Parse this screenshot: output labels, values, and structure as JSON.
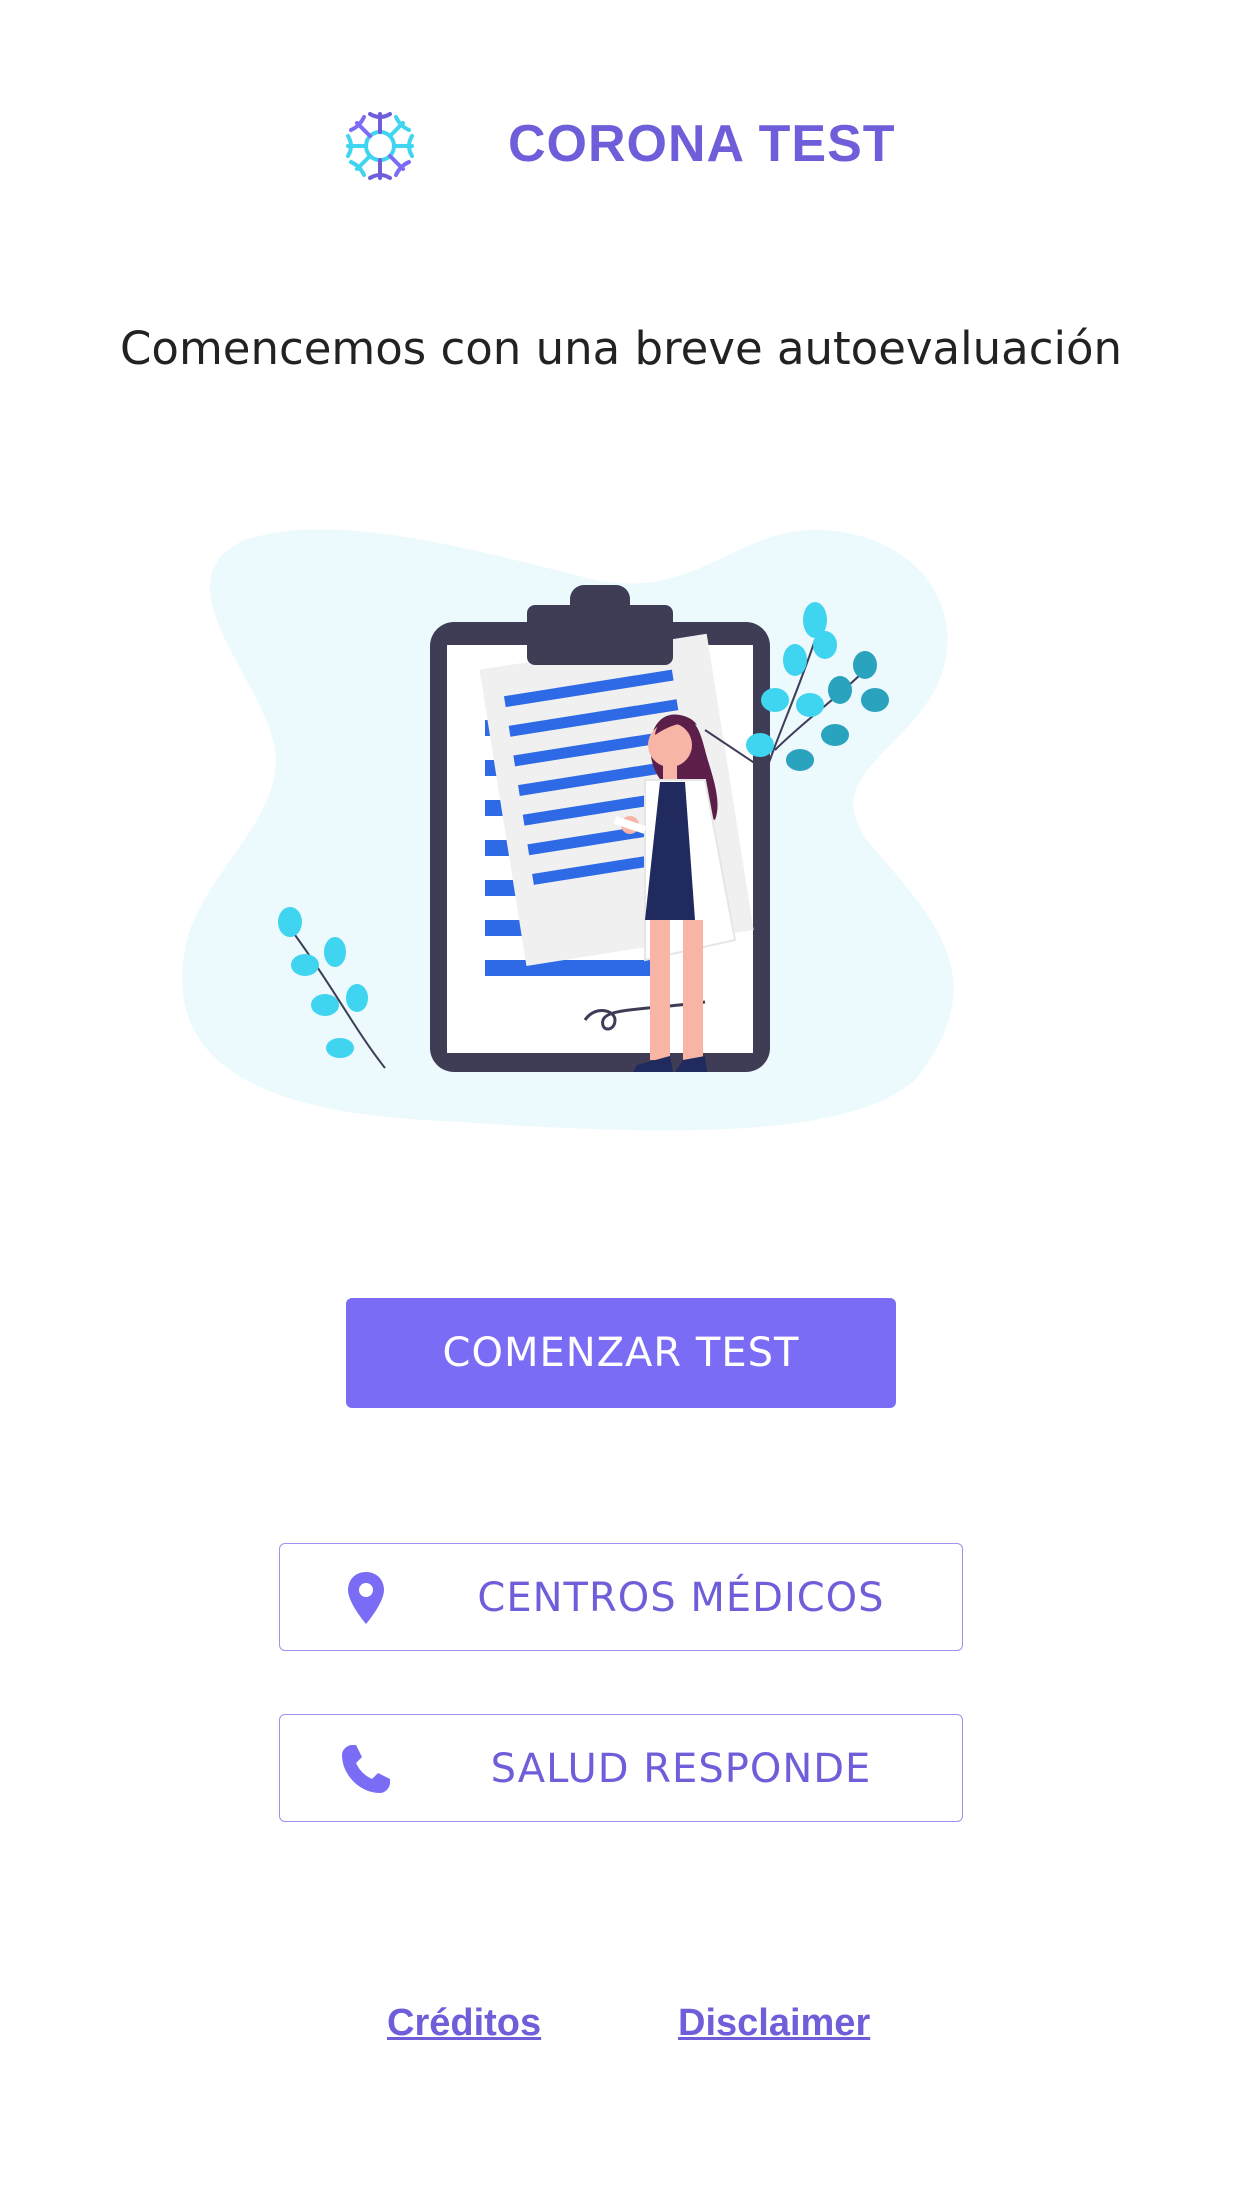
{
  "header": {
    "logo_icon": "virus-icon",
    "title": "CORONA TEST"
  },
  "main": {
    "subtitle": "Comencemos con una breve autoevaluación",
    "illustration": "doctor-with-clipboard-illustration",
    "start_button_label": "COMENZAR TEST"
  },
  "actions": {
    "centros": {
      "label": "CENTROS MÉDICOS",
      "icon": "location-pin-icon"
    },
    "salud": {
      "label": "SALUD RESPONDE",
      "icon": "phone-icon"
    }
  },
  "footer": {
    "creditos": "Créditos",
    "disclaimer": "Disclaimer"
  },
  "colors": {
    "accent": "#7b6cf6",
    "accent_text": "#6e5ed9",
    "outline": "#9d92ee",
    "logo_cyan": "#3fd4f0",
    "illustration_bar": "#2f6ae6",
    "illustration_dark": "#3f3d56",
    "blob_bg": "#ecf9fd"
  }
}
